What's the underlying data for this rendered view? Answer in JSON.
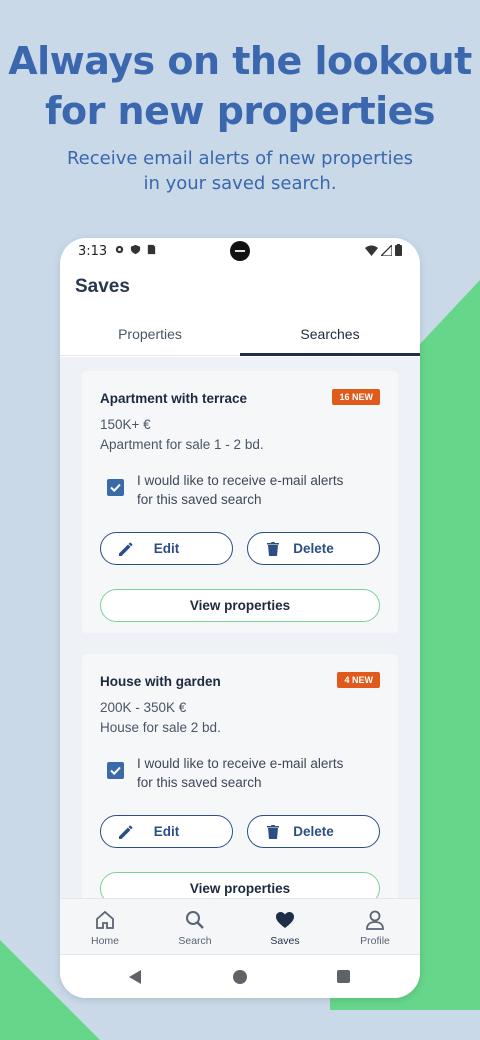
{
  "promo": {
    "headline_line1": "Always on the lookout",
    "headline_line2": "for new properties",
    "subhead_line1": "Receive email alerts of new properties",
    "subhead_line2": "in your saved search."
  },
  "status_bar": {
    "time": "3:13"
  },
  "app": {
    "title": "Saves",
    "tabs": [
      {
        "label": "Properties",
        "active": false
      },
      {
        "label": "Searches",
        "active": true
      }
    ]
  },
  "searches": [
    {
      "title": "Apartment with terrace",
      "badge": "16 NEW",
      "price": "150K+ €",
      "description": "Apartment for sale 1 - 2 bd.",
      "alert_checked": true,
      "alert_line1": "I would like to receive e-mail alerts",
      "alert_line2": "for this saved search",
      "edit_label": "Edit",
      "delete_label": "Delete",
      "view_label": "View properties"
    },
    {
      "title": "House with garden",
      "badge": "4 NEW",
      "price": "200K - 350K €",
      "description": "House for sale 2 bd.",
      "alert_checked": true,
      "alert_line1": "I would like to receive e-mail alerts",
      "alert_line2": "for this saved search",
      "edit_label": "Edit",
      "delete_label": "Delete",
      "view_label": "View properties"
    }
  ],
  "bottom_nav": [
    {
      "label": "Home",
      "icon": "home-icon",
      "active": false
    },
    {
      "label": "Search",
      "icon": "search-icon",
      "active": false
    },
    {
      "label": "Saves",
      "icon": "heart-icon",
      "active": true
    },
    {
      "label": "Profile",
      "icon": "profile-icon",
      "active": false
    }
  ],
  "colors": {
    "background": "#c9d9e8",
    "accent_green": "#66d68a",
    "headline_blue": "#3a67ad",
    "badge_orange": "#e05a1c",
    "button_blue": "#2c4e85"
  }
}
